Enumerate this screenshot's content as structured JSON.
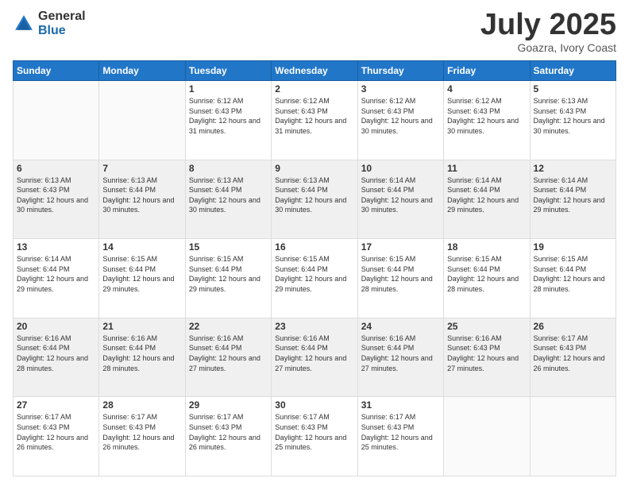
{
  "logo": {
    "general": "General",
    "blue": "Blue"
  },
  "title": {
    "month_year": "July 2025",
    "location": "Goazra, Ivory Coast"
  },
  "weekdays": [
    "Sunday",
    "Monday",
    "Tuesday",
    "Wednesday",
    "Thursday",
    "Friday",
    "Saturday"
  ],
  "weeks": [
    [
      {
        "day": "",
        "info": ""
      },
      {
        "day": "",
        "info": ""
      },
      {
        "day": "1",
        "info": "Sunrise: 6:12 AM\nSunset: 6:43 PM\nDaylight: 12 hours and 31 minutes."
      },
      {
        "day": "2",
        "info": "Sunrise: 6:12 AM\nSunset: 6:43 PM\nDaylight: 12 hours and 31 minutes."
      },
      {
        "day": "3",
        "info": "Sunrise: 6:12 AM\nSunset: 6:43 PM\nDaylight: 12 hours and 30 minutes."
      },
      {
        "day": "4",
        "info": "Sunrise: 6:12 AM\nSunset: 6:43 PM\nDaylight: 12 hours and 30 minutes."
      },
      {
        "day": "5",
        "info": "Sunrise: 6:13 AM\nSunset: 6:43 PM\nDaylight: 12 hours and 30 minutes."
      }
    ],
    [
      {
        "day": "6",
        "info": "Sunrise: 6:13 AM\nSunset: 6:43 PM\nDaylight: 12 hours and 30 minutes."
      },
      {
        "day": "7",
        "info": "Sunrise: 6:13 AM\nSunset: 6:44 PM\nDaylight: 12 hours and 30 minutes."
      },
      {
        "day": "8",
        "info": "Sunrise: 6:13 AM\nSunset: 6:44 PM\nDaylight: 12 hours and 30 minutes."
      },
      {
        "day": "9",
        "info": "Sunrise: 6:13 AM\nSunset: 6:44 PM\nDaylight: 12 hours and 30 minutes."
      },
      {
        "day": "10",
        "info": "Sunrise: 6:14 AM\nSunset: 6:44 PM\nDaylight: 12 hours and 30 minutes."
      },
      {
        "day": "11",
        "info": "Sunrise: 6:14 AM\nSunset: 6:44 PM\nDaylight: 12 hours and 29 minutes."
      },
      {
        "day": "12",
        "info": "Sunrise: 6:14 AM\nSunset: 6:44 PM\nDaylight: 12 hours and 29 minutes."
      }
    ],
    [
      {
        "day": "13",
        "info": "Sunrise: 6:14 AM\nSunset: 6:44 PM\nDaylight: 12 hours and 29 minutes."
      },
      {
        "day": "14",
        "info": "Sunrise: 6:15 AM\nSunset: 6:44 PM\nDaylight: 12 hours and 29 minutes."
      },
      {
        "day": "15",
        "info": "Sunrise: 6:15 AM\nSunset: 6:44 PM\nDaylight: 12 hours and 29 minutes."
      },
      {
        "day": "16",
        "info": "Sunrise: 6:15 AM\nSunset: 6:44 PM\nDaylight: 12 hours and 29 minutes."
      },
      {
        "day": "17",
        "info": "Sunrise: 6:15 AM\nSunset: 6:44 PM\nDaylight: 12 hours and 28 minutes."
      },
      {
        "day": "18",
        "info": "Sunrise: 6:15 AM\nSunset: 6:44 PM\nDaylight: 12 hours and 28 minutes."
      },
      {
        "day": "19",
        "info": "Sunrise: 6:15 AM\nSunset: 6:44 PM\nDaylight: 12 hours and 28 minutes."
      }
    ],
    [
      {
        "day": "20",
        "info": "Sunrise: 6:16 AM\nSunset: 6:44 PM\nDaylight: 12 hours and 28 minutes."
      },
      {
        "day": "21",
        "info": "Sunrise: 6:16 AM\nSunset: 6:44 PM\nDaylight: 12 hours and 28 minutes."
      },
      {
        "day": "22",
        "info": "Sunrise: 6:16 AM\nSunset: 6:44 PM\nDaylight: 12 hours and 27 minutes."
      },
      {
        "day": "23",
        "info": "Sunrise: 6:16 AM\nSunset: 6:44 PM\nDaylight: 12 hours and 27 minutes."
      },
      {
        "day": "24",
        "info": "Sunrise: 6:16 AM\nSunset: 6:44 PM\nDaylight: 12 hours and 27 minutes."
      },
      {
        "day": "25",
        "info": "Sunrise: 6:16 AM\nSunset: 6:43 PM\nDaylight: 12 hours and 27 minutes."
      },
      {
        "day": "26",
        "info": "Sunrise: 6:17 AM\nSunset: 6:43 PM\nDaylight: 12 hours and 26 minutes."
      }
    ],
    [
      {
        "day": "27",
        "info": "Sunrise: 6:17 AM\nSunset: 6:43 PM\nDaylight: 12 hours and 26 minutes."
      },
      {
        "day": "28",
        "info": "Sunrise: 6:17 AM\nSunset: 6:43 PM\nDaylight: 12 hours and 26 minutes."
      },
      {
        "day": "29",
        "info": "Sunrise: 6:17 AM\nSunset: 6:43 PM\nDaylight: 12 hours and 26 minutes."
      },
      {
        "day": "30",
        "info": "Sunrise: 6:17 AM\nSunset: 6:43 PM\nDaylight: 12 hours and 25 minutes."
      },
      {
        "day": "31",
        "info": "Sunrise: 6:17 AM\nSunset: 6:43 PM\nDaylight: 12 hours and 25 minutes."
      },
      {
        "day": "",
        "info": ""
      },
      {
        "day": "",
        "info": ""
      }
    ]
  ]
}
